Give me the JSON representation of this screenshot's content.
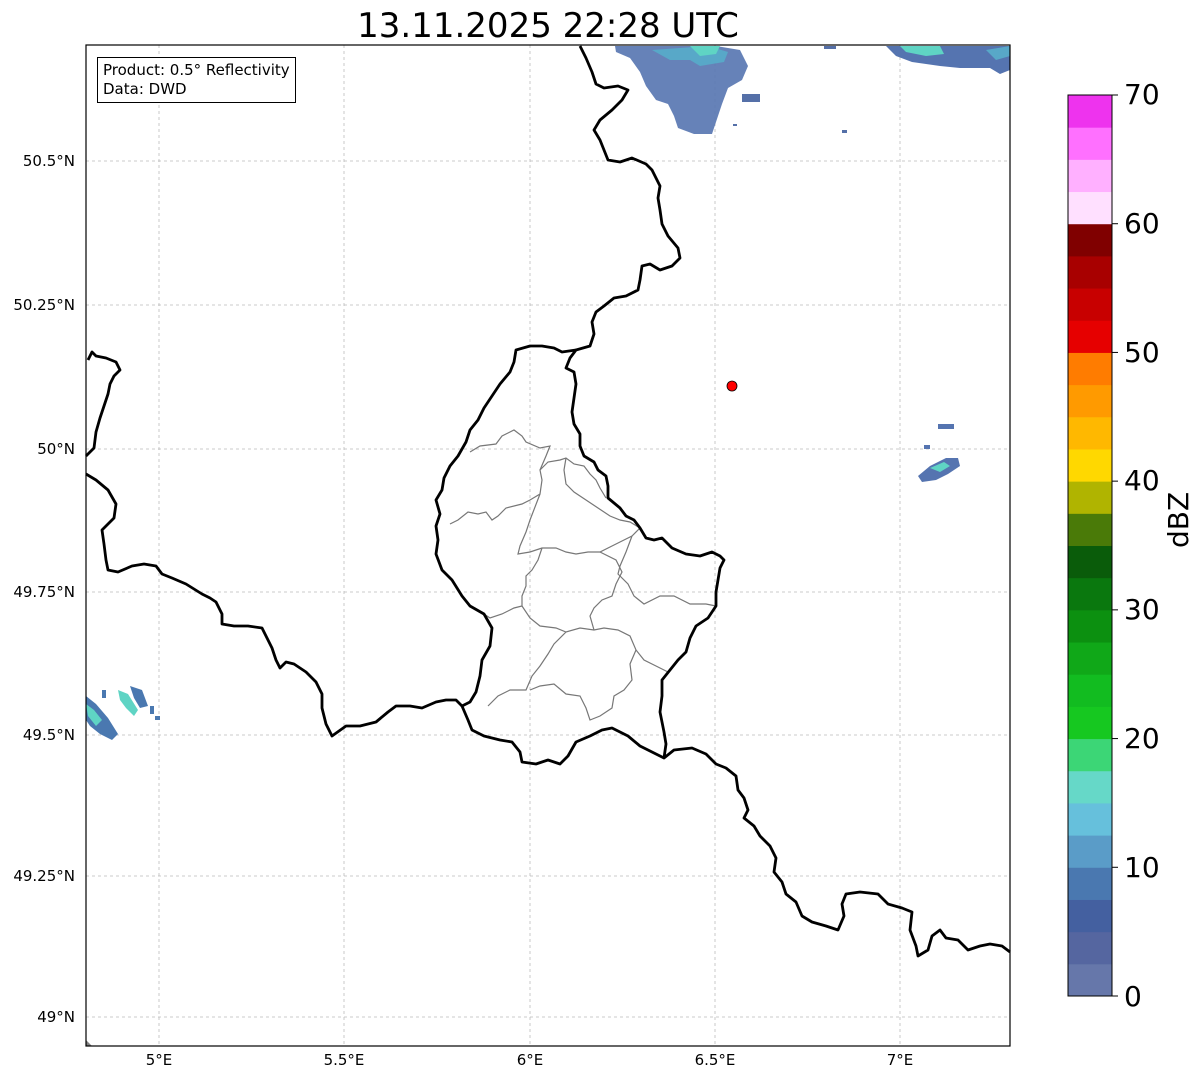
{
  "title": "13.11.2025 22:28 UTC",
  "info_box": {
    "product": "Product: 0.5° Reflectivity",
    "data": "Data: DWD"
  },
  "latitude_labels": [
    "50.5°N",
    "50.25°N",
    "50°N",
    "49.75°N",
    "49.5°N",
    "49.25°N",
    "49°N"
  ],
  "longitude_labels": [
    "5°E",
    "5.5°E",
    "6°E",
    "6.5°E",
    "7°E"
  ],
  "colorbar": {
    "title": "dBZ",
    "tick_labels": [
      "0",
      "10",
      "20",
      "30",
      "40",
      "50",
      "60",
      "70"
    ],
    "colors": [
      "#6677aa",
      "#5566a0",
      "#4460a0",
      "#4a78b0",
      "#5a9cc8",
      "#66c0dc",
      "#66d8c8",
      "#3cd676",
      "#16c820",
      "#12bc20",
      "#10a818",
      "#0c9010",
      "#0a780e",
      "#0a5c0a",
      "#4a7a08",
      "#b0b400",
      "#ffd800",
      "#ffb800",
      "#ff9a00",
      "#ff7c00",
      "#e60000",
      "#c80000",
      "#a80000",
      "#800000",
      "#ffe0ff",
      "#ffb0ff",
      "#ff70ff",
      "#ee33ee"
    ]
  },
  "marker": {
    "lon": 6.55,
    "lat": 50.11,
    "color": "#ff0000"
  },
  "map_extent": {
    "lon_min": 4.8,
    "lon_max": 7.3,
    "lat_min": 48.95,
    "lat_max": 50.7
  }
}
